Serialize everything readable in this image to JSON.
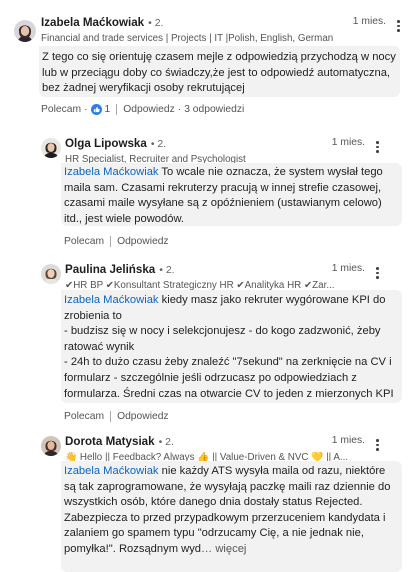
{
  "main_comment": {
    "author": "Izabela Maćkowiak",
    "degree": "• 2.",
    "headline": "Financial and trade services | Projects | IT |Polish, English, German",
    "time": "1 mies.",
    "text": "Z tego co się orientuję czasem mejle z odpowiedzią przychodzą w nocy lub w przeciągu doby co świadczy,że jest to odpowiedź automatyczna, bez żadnej weryfikacji osoby rekrutującej",
    "like_label": "Polecam",
    "like_count": "1",
    "reply_label": "Odpowiedz",
    "replies_count": "3 odpowiedzi"
  },
  "replies": [
    {
      "author": "Olga Lipowska",
      "degree": "• 2.",
      "headline": "HR Specialist, Recruiter and Psychologist",
      "time": "1 mies.",
      "mention": "Izabela Maćkowiak",
      "text": " To wcale nie oznacza, że system wysłał tego maila sam. Czasami rekruterzy pracują w innej strefie czasowej, czasami maile wysyłane są z opóźnieniem (ustawianym celowo) itd., jest wiele powodów.",
      "like_label": "Polecam",
      "reply_label": "Odpowiedz"
    },
    {
      "author": "Paulina Jelińska",
      "degree": "• 2.",
      "headline": "✔HR BP ✔Konsultant Strategiczny HR ✔Analityka HR ✔Zar...",
      "time": "1 mies.",
      "mention": "Izabela Maćkowiak",
      "text_lines": [
        " kiedy masz jako rekruter wygórowane KPI do zrobienia to",
        "- budzisz się w nocy i selekcjonujesz - do kogo zadzwonić, żeby ratować wynik",
        "- 24h to dużo czasu żeby znaleźć \"7sekund\" na zerknięcie na CV i formularz - szczególnie jeśli odrzucasz po odpowiedziach z formularza. Średni czas na otwarcie CV to jeden z mierzonych KPI"
      ],
      "like_label": "Polecam",
      "reply_label": "Odpowiedz"
    },
    {
      "author": "Dorota Matysiak",
      "degree": "• 2.",
      "headline": "👋 Hello || Feedback? Always 👍 || Value-Driven & NVC 💛 || A...",
      "time": "1 mies.",
      "mention": "Izabela Maćkowiak",
      "text": " nie każdy ATS wysyła maila od razu, niektóre są tak zaprogramowane, że wysyłają paczkę maili raz dziennie do wszystkich osób, które danego dnia dostały status Rejected. Zabezpiecza to przed przypadkowym przerzuceniem kandydata i zalaniem go spamem typu \"odrzucamy Cię, a nie jednak nie, pomyłka!\". Rozsądnym wyd",
      "ellipsis": "…",
      "more_label": "więcej"
    }
  ],
  "colors": {
    "mention": "#0a66c2",
    "bubble": "#f2f2f2",
    "like_badge": "#2d7ee6"
  }
}
